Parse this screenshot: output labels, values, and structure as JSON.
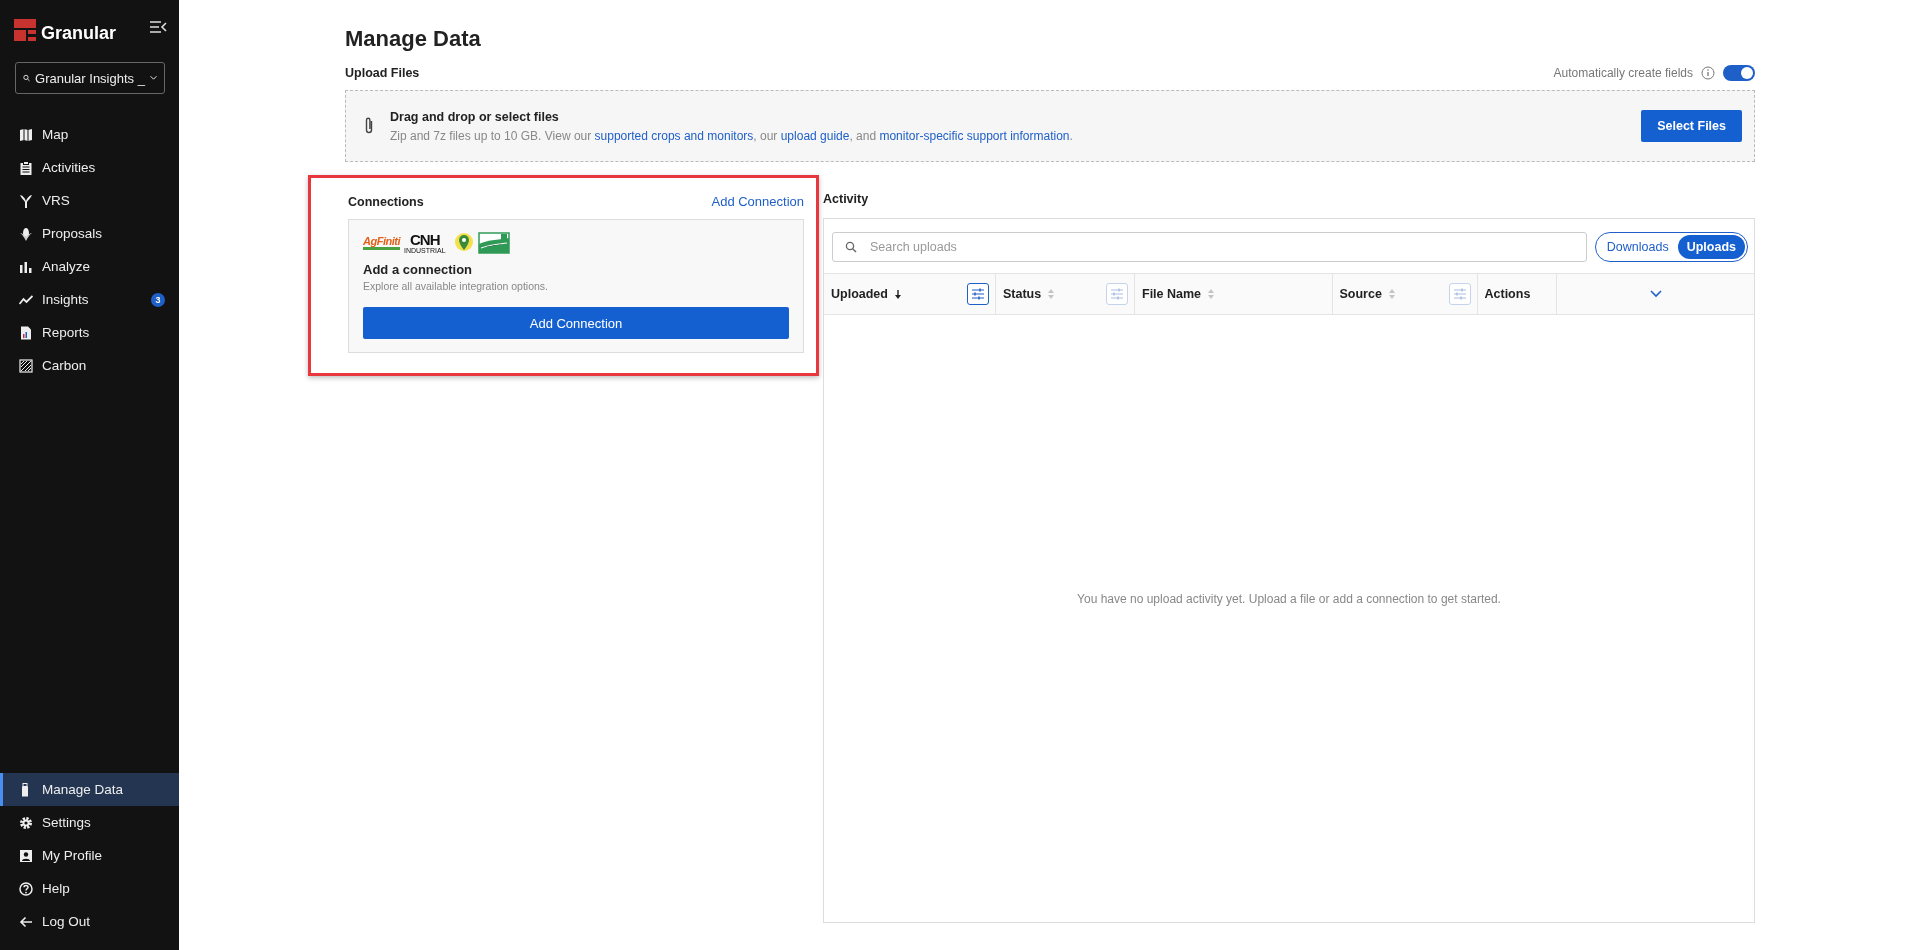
{
  "sidebar": {
    "brand": "Granular",
    "org_selector": "Granular Insights _",
    "items": [
      {
        "label": "Map",
        "selected": false
      },
      {
        "label": "Activities",
        "selected": false
      },
      {
        "label": "VRS",
        "selected": false
      },
      {
        "label": "Proposals",
        "selected": false
      },
      {
        "label": "Analyze",
        "selected": false
      },
      {
        "label": "Insights",
        "selected": false,
        "badge": "3"
      },
      {
        "label": "Reports",
        "selected": false
      },
      {
        "label": "Carbon",
        "selected": false
      }
    ],
    "bottom_items": [
      {
        "label": "Manage Data",
        "selected": true
      },
      {
        "label": "Settings",
        "selected": false
      },
      {
        "label": "My Profile",
        "selected": false
      },
      {
        "label": "Help",
        "selected": false
      },
      {
        "label": "Log Out",
        "selected": false
      }
    ]
  },
  "page": {
    "title": "Manage Data"
  },
  "upload": {
    "heading": "Upload Files",
    "auto_create": {
      "label": "Automatically create fields",
      "on": true
    },
    "drop_title": "Drag and drop or select files",
    "description": [
      {
        "kind": "text",
        "text": "Zip and 7z files up to 10 GB. View our "
      },
      {
        "kind": "link",
        "text": "supported crops and monitors"
      },
      {
        "kind": "text",
        "text": ", our "
      },
      {
        "kind": "link",
        "text": "upload guide"
      },
      {
        "kind": "text",
        "text": ", and "
      },
      {
        "kind": "link",
        "text": "monitor-specific support information"
      },
      {
        "kind": "text",
        "text": "."
      }
    ],
    "button": "Select Files"
  },
  "connections": {
    "heading": "Connections",
    "highlighted": true,
    "link": "Add Connection",
    "logos": [
      {
        "kind": "agfiniti",
        "text": "AgFiniti"
      },
      {
        "kind": "cnh",
        "text": "CNH",
        "subtext": "INDUSTRIAL"
      },
      {
        "kind": "pin"
      },
      {
        "kind": "field"
      }
    ],
    "card_title": "Add a connection",
    "card_subtitle": "Explore all available integration options.",
    "button": "Add Connection"
  },
  "activity": {
    "heading": "Activity",
    "search": {
      "placeholder": "Search uploads"
    },
    "tabs": [
      {
        "label": "Downloads",
        "selected": false
      },
      {
        "label": "Uploads",
        "selected": true
      }
    ],
    "columns": [
      {
        "label": "Uploaded",
        "sorted": true,
        "filter_active": true
      },
      {
        "label": "Status",
        "sorted": false,
        "filter_active": false
      },
      {
        "label": "File Name",
        "sorted": false
      },
      {
        "label": "Source",
        "sorted": false,
        "filter_active": false
      },
      {
        "label": "Actions"
      }
    ],
    "empty_message": "You have no upload activity yet. Upload a file or add a connection to get started."
  }
}
